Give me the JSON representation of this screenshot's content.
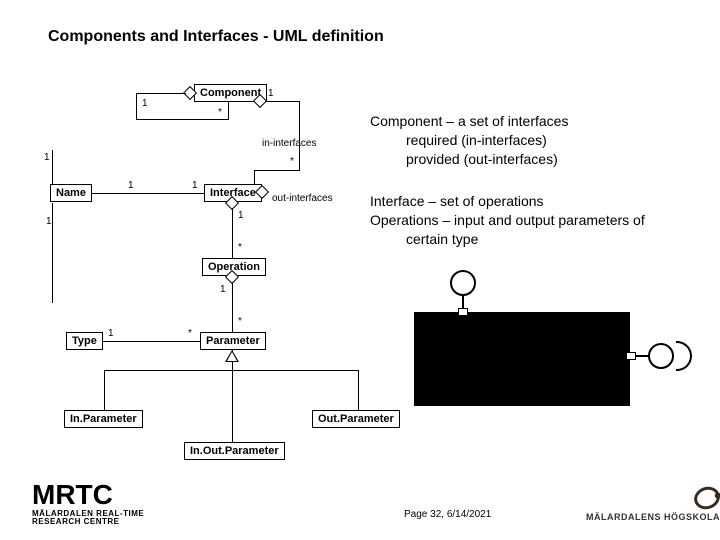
{
  "title": "Components and Interfaces  - UML definition",
  "uml": {
    "component": "Component",
    "name": "Name",
    "interface": "Interface",
    "operation": "Operation",
    "type": "Type",
    "parameter": "Parameter",
    "in_parameter": "In.Parameter",
    "out_parameter": "Out.Parameter",
    "inout_parameter": "In.Out.Parameter",
    "label_in_interfaces": "in-interfaces",
    "label_out_interfaces": "out-interfaces",
    "mult_one": "1",
    "mult_many": "*"
  },
  "desc": {
    "l1": "Component – a set of interfaces",
    "l2": "required (in-interfaces)",
    "l3": "provided (out-interfaces)",
    "l4": "Interface – set of operations",
    "l5": "Operations – input and output parameters of",
    "l6": "certain type"
  },
  "footer": {
    "mrtc": "MRTC",
    "mrtc_sub1": "MÄLARDALEN REAL-TIME",
    "mrtc_sub2": "RESEARCH CENTRE",
    "page": "Page 32, 6/14/2021",
    "uni": "MÄLARDALENS HÖGSKOLA"
  }
}
